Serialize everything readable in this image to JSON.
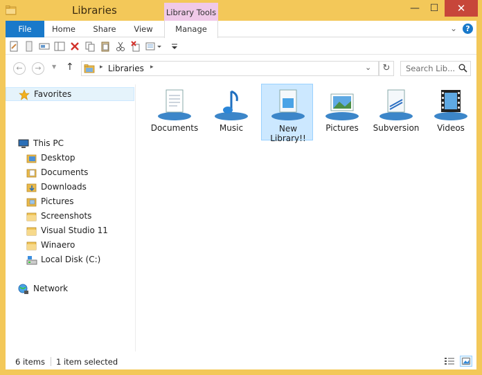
{
  "window": {
    "title": "Libraries",
    "context_tab_group": "Library Tools",
    "minimize_glyph": "—",
    "maximize_glyph": "☐",
    "close_glyph": "✕"
  },
  "ribbon": {
    "tabs": {
      "file": "File",
      "home": "Home",
      "share": "Share",
      "view": "View",
      "manage": "Manage"
    },
    "collapse_glyph": "⌄",
    "help_glyph": "?"
  },
  "address": {
    "back_glyph": "←",
    "forward_glyph": "→",
    "up_glyph": "↑",
    "arrow_glyph": "▸",
    "path": "Libraries",
    "dropdown_glyph": "⌄",
    "refresh_glyph": "↻"
  },
  "search": {
    "placeholder": "Search Lib..."
  },
  "nav": {
    "favorites": "Favorites",
    "this_pc": "This PC",
    "items": [
      {
        "label": "Desktop"
      },
      {
        "label": "Documents"
      },
      {
        "label": "Downloads"
      },
      {
        "label": "Pictures"
      },
      {
        "label": "Screenshots"
      },
      {
        "label": "Visual Studio 11"
      },
      {
        "label": "Winaero"
      },
      {
        "label": "Local Disk (C:)"
      }
    ],
    "network": "Network"
  },
  "libraries": [
    {
      "label": "Documents",
      "icon": "documents-library-icon"
    },
    {
      "label": "Music",
      "icon": "music-library-icon"
    },
    {
      "label": "New Library!!",
      "icon": "new-library-icon",
      "selected": true
    },
    {
      "label": "Pictures",
      "icon": "pictures-library-icon"
    },
    {
      "label": "Subversion",
      "icon": "subversion-library-icon"
    },
    {
      "label": "Videos",
      "icon": "videos-library-icon"
    }
  ],
  "status": {
    "count": "6 items",
    "selection": "1 item selected"
  },
  "colors": {
    "frame": "#f3c859",
    "file_tab": "#1979ca",
    "close_button": "#c7463a",
    "context_tab": "#f0c9e8",
    "selection": "#cce8ff"
  }
}
